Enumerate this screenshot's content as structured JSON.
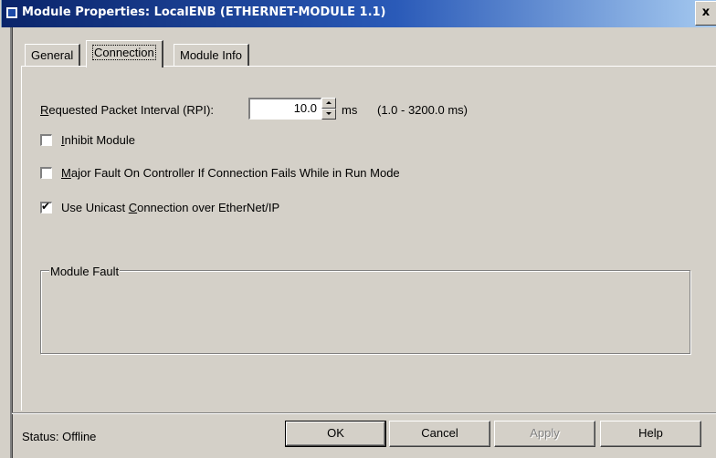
{
  "window": {
    "title": "Module Properties: LocalENB (ETHERNET-MODULE 1.1)",
    "close_glyph": "x"
  },
  "tabs": [
    {
      "label": "General",
      "active": false
    },
    {
      "label": "Connection",
      "active": true
    },
    {
      "label": "Module Info",
      "active": false
    }
  ],
  "connection": {
    "rpi_label_prefix": "R",
    "rpi_label_rest": "equested Packet Interval (RPI):",
    "rpi_value": "10.0",
    "rpi_unit": "ms",
    "rpi_range": "(1.0 - 3200.0 ms)",
    "inhibit": {
      "mnemonic": "I",
      "rest": "nhibit Module",
      "checked": false
    },
    "major_fault": {
      "mnemonic": "M",
      "rest": "ajor Fault On Controller If Connection Fails While in Run Mode",
      "checked": false
    },
    "unicast": {
      "before": "Use Unicast ",
      "mnemonic": "C",
      "rest": "onnection over EtherNet/IP",
      "checked": true
    }
  },
  "module_fault": {
    "label": "Module Fault"
  },
  "status": {
    "text": "Status:  Offline"
  },
  "buttons": {
    "ok": "OK",
    "cancel": "Cancel",
    "apply": "Apply",
    "help": "Help"
  },
  "colors": {
    "dialog_face": "#d4d0c8",
    "titlebar_start": "#0a246a",
    "titlebar_end": "#a6caf0"
  },
  "icons": {
    "app": "module-properties-icon",
    "check": "✔"
  }
}
